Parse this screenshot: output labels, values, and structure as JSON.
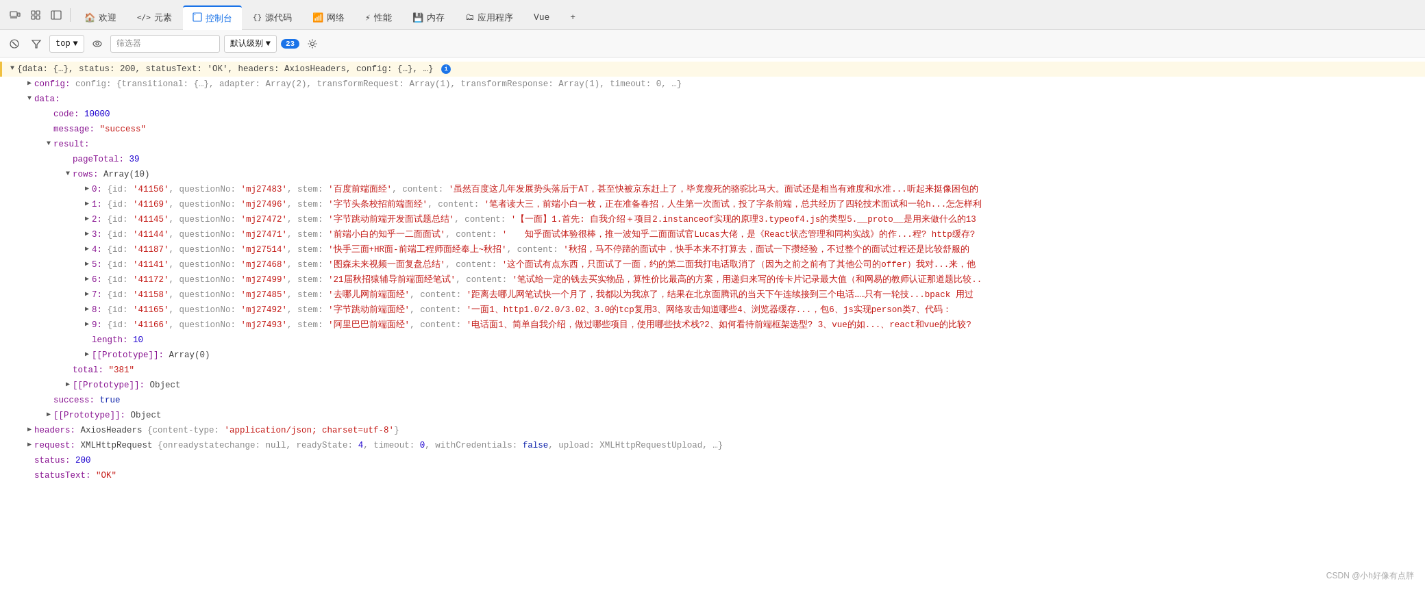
{
  "nav": {
    "icons": [
      "device-icon",
      "layers-icon",
      "sidebar-icon"
    ],
    "tabs": [
      {
        "label": "欢迎",
        "icon": "🏠",
        "active": false
      },
      {
        "label": "元素",
        "icon": "</>",
        "active": false
      },
      {
        "label": "控制台",
        "icon": "📋",
        "active": true
      },
      {
        "label": "源代码",
        "icon": "{ }",
        "active": false
      },
      {
        "label": "网络",
        "icon": "📶",
        "active": false
      },
      {
        "label": "性能",
        "icon": "⚡",
        "active": false
      },
      {
        "label": "内存",
        "icon": "💾",
        "active": false
      },
      {
        "label": "应用程序",
        "icon": "🗂",
        "active": false
      },
      {
        "label": "Vue",
        "icon": "",
        "active": false
      }
    ],
    "plus_label": "+"
  },
  "toolbar": {
    "top_label": "top",
    "filter_placeholder": "筛选器",
    "level_label": "默认级别",
    "badge_count": "23"
  },
  "console": {
    "root_line": "{data: {…}, status: 200, statusText: 'OK', headers: AxiosHeaders, config: {…}, …}",
    "config_line": "config: {transitional: {…}, adapter: Array(2), transformRequest: Array(1), transformResponse: Array(1), timeout: 0, …}",
    "data_key": "data:",
    "code_line": "code: 10000",
    "message_line": "message: \"success\"",
    "result_key": "result:",
    "pageTotal_line": "pageTotal: 39",
    "rows_label": "rows: Array(10)",
    "row0": "0: {id: '41156', questionNo: 'mj27483', stem: '百度前端面经', content: '虽然百度这几年发展势头落后于AT，甚至快被京东赶上了，毕竟瘦死的骆驼比马大。面试还是相当有难度和水准...听起来挺像困包的",
    "row1": "1: {id: '41169', questionNo: 'mj27496', stem: '字节头条校招前端面经', content: '笔者读大三，前端小白一枚，正在准备春招，人生第一次面试，投了字条前端，总共经历了四轮技术面试和一轮h...怎怎样利",
    "row2": "2: {id: '41145', questionNo: 'mj27472', stem: '字节跳动前端开发面试题总结', content: '【一面】1.首先: 自我介绍＋项目2.instanceof实现的原理3.typeof4.js的类型5.__proto__是用来做什么的13",
    "row3": "3: {id: '41144', questionNo: 'mj27471', stem: '前端小白的知乎一二面面试', content: '    知乎面试体验很棒，推一波知乎二面面试官Lucas大佬，是《React状态管理和同构实战》的作...程? http缓存?",
    "row4": "4: {id: '41187', questionNo: 'mj27514', stem: '快手三面+HR面-前端工程师面经奉上~秋招', content: '秋招，马不停蹄的面试中，快手本来不打算去，面试一下攒经验，不过整个的面试过程还是比较舒服的",
    "row5": "5: {id: '41141', questionNo: 'mj27468', stem: '图森未来视频一面复盘总结', content: '这个面试有点东西，只面试了一面，约的第二面我打电话取消了（因为之前之前有了其他公司的offer）我对...来，他",
    "row6": "6: {id: '41172', questionNo: 'mj27499', stem: '21届秋招猿辅导前端面经笔试', content: '笔试给一定的钱去买实物品，算性价比最高的方案，用递归来写的传卡片记录最大值（和网易的教师认证那道题比较..",
    "row7": "7: {id: '41158', questionNo: 'mj27485', stem: '去哪儿网前端面经', content: '距离去哪儿网笔试快一个月了，我都以为我凉了，结果在北京面腾讯的当天下午连续接到三个电话……只有一轮技...bpack 用过",
    "row8": "8: {id: '41165', questionNo: 'mj27492', stem: '字节跳动前端面经', content: '一面1、http1.0/2.0/3.02、3.0的tcp复用3、网络攻击知道哪些4、浏览器缓存...，包6、js实现person类7、代码：",
    "row9": "9: {id: '41166', questionNo: 'mj27493', stem: '阿里巴巴前端面经', content: '电话面1、简单自我介绍，做过哪些项目，使用哪些技术栈?2、如何看待前端框架选型? 3、vue的如...、react和vue的比较?",
    "length_line": "length: 10",
    "prototype_array": "[[Prototype]]: Array(0)",
    "total_line": "total: \"381\"",
    "prototype_obj": "[[Prototype]]: Object",
    "success_line": "success: true",
    "prototype_obj2": "[[Prototype]]: Object",
    "headers_line": "headers: AxiosHeaders {content-type: 'application/json; charset=utf-8'}",
    "request_line": "request: XMLHttpRequest {onreadystatechange: null, readyState: 4, timeout: 0, withCredentials: false, upload: XMLHttpRequestUpload, …}",
    "status_line": "status: 200",
    "statusText_line": "statusText: \"OK\""
  },
  "watermark": {
    "text": "CSDN @小h好像有点胖"
  }
}
